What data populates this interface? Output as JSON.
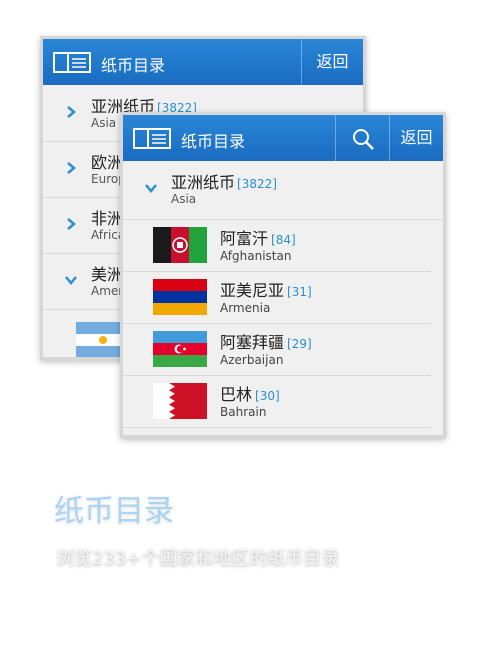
{
  "app": {
    "title": "纸币目录",
    "back_label": "返回"
  },
  "back_screen": {
    "categories": [
      {
        "name": "亚洲纸币",
        "count": "[3822]",
        "english": "Asia",
        "expanded": false
      },
      {
        "name": "欧洲",
        "count": "",
        "english": "Europ",
        "expanded": false
      },
      {
        "name": "非洲",
        "count": "",
        "english": "Africa",
        "expanded": false
      },
      {
        "name": "美洲",
        "count": "",
        "english": "Ameri",
        "expanded": true
      }
    ],
    "peek_flag": "Argentina flag"
  },
  "front_screen": {
    "category": {
      "name": "亚洲纸币",
      "count": "[3822]",
      "english": "Asia"
    },
    "countries": [
      {
        "name": "阿富汗",
        "count": "[84]",
        "english": "Afghanistan",
        "flag": "afghanistan-flag"
      },
      {
        "name": "亚美尼亚",
        "count": "[31]",
        "english": "Armenia",
        "flag": "armenia-flag"
      },
      {
        "name": "阿塞拜疆",
        "count": "[29]",
        "english": "Azerbaijan",
        "flag": "azerbaijan-flag"
      },
      {
        "name": "巴林",
        "count": "[30]",
        "english": "Bahrain",
        "flag": "bahrain-flag"
      }
    ]
  },
  "promo": {
    "title": "纸币目录",
    "subtitle": "浏览233+个国家和地区的纸币目录"
  },
  "colors": {
    "appbar": "#1f78cc",
    "accent_count": "#2a8fd0",
    "promo_title": "#a9d4f3"
  }
}
